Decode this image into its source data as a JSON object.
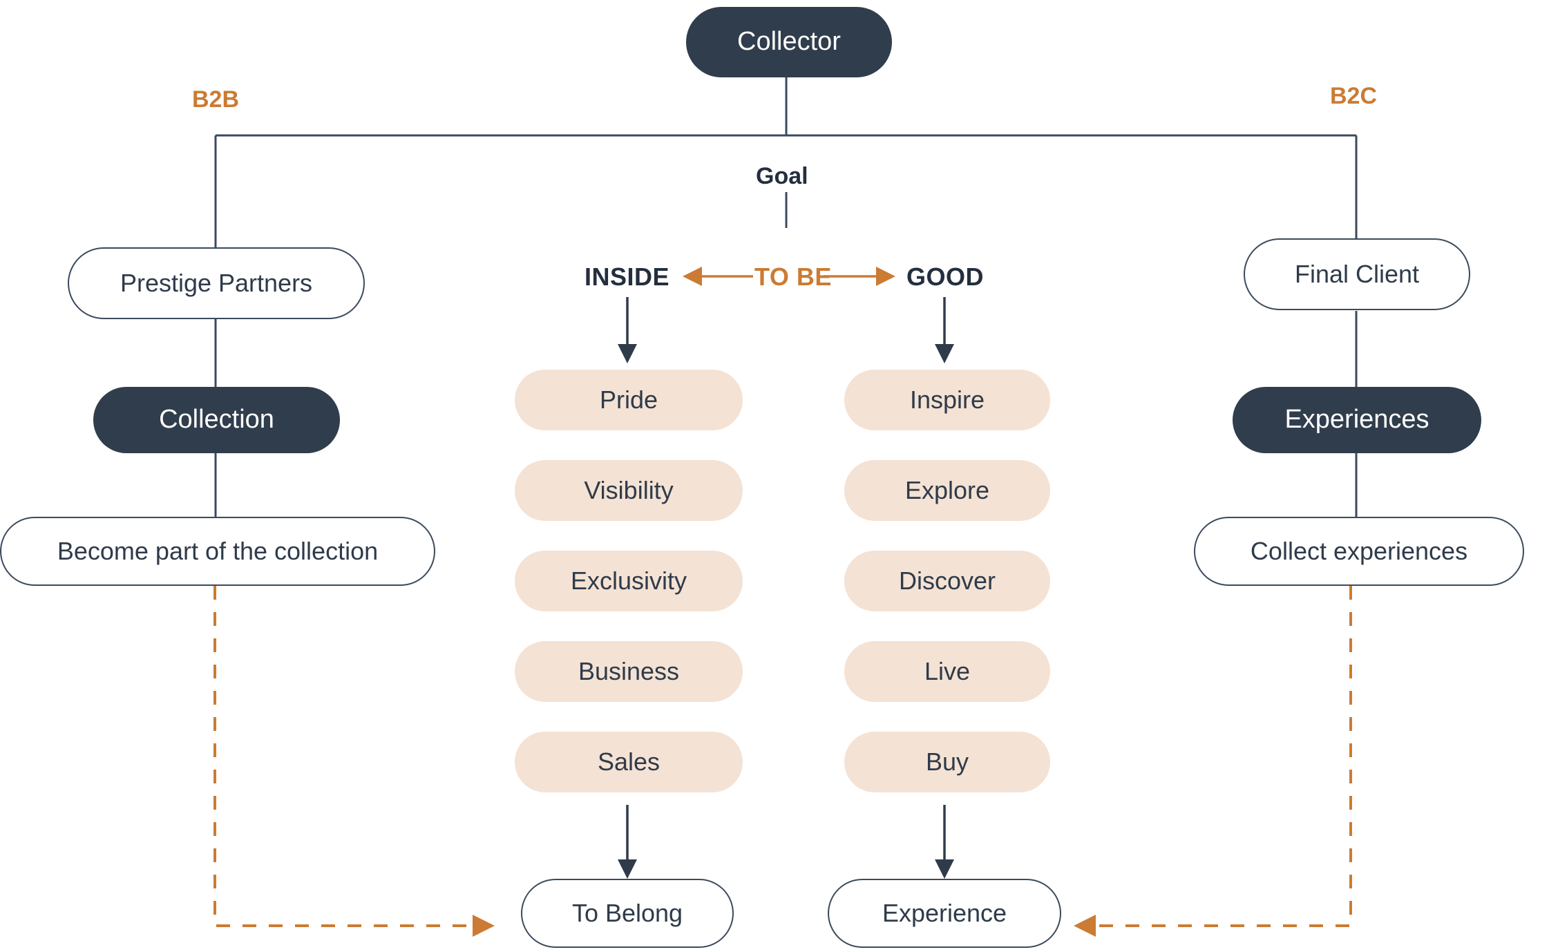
{
  "diagram": {
    "title_node": {
      "label": "Collector"
    },
    "branch_labels": {
      "left": "B2B",
      "right": "B2C"
    },
    "goal_label": "Goal",
    "axis": {
      "left": "INSIDE",
      "center": "TO BE",
      "right": "GOOD"
    },
    "left_branch": {
      "actor": "Prestige Partners",
      "asset": "Collection",
      "action": "Become part of the collection"
    },
    "right_branch": {
      "actor": "Final Client",
      "asset": "Experiences",
      "action": "Collect experiences"
    },
    "inside_column": [
      "Pride",
      "Visibility",
      "Exclusivity",
      "Business",
      "Sales"
    ],
    "good_column": [
      "Inspire",
      "Explore",
      "Discover",
      "Live",
      "Buy"
    ],
    "outcomes": {
      "left": "To Belong",
      "right": "Experience"
    },
    "colors": {
      "dark": "#303d4c",
      "outline_stroke": "#3b4a5c",
      "pill_fill": "#f4e2d4",
      "accent_orange": "#cb7b33",
      "text_dark": "#2f3b4a",
      "background": "#ffffff"
    }
  }
}
